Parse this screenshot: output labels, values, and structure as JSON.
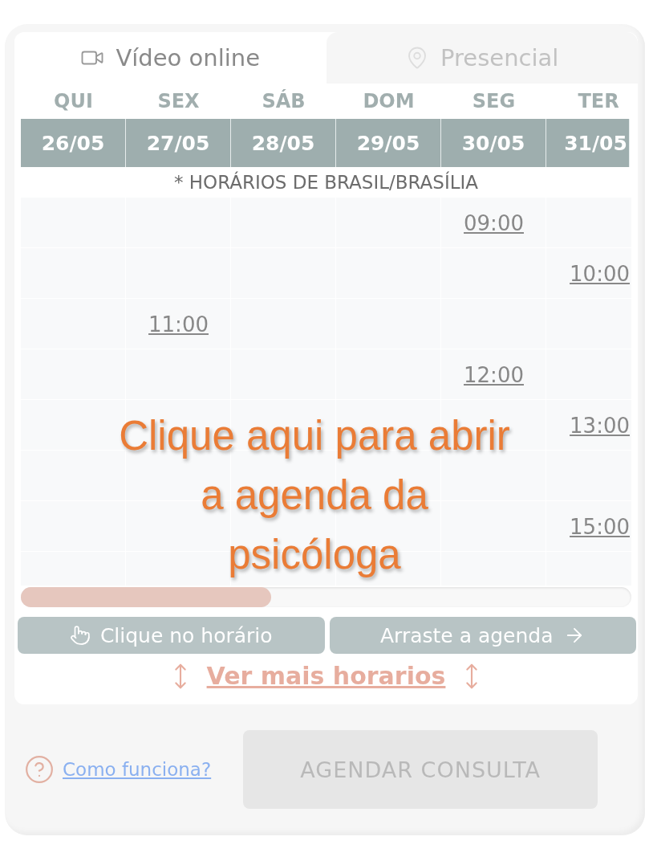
{
  "tabs": [
    {
      "label": "Vídeo online",
      "kind": "video",
      "selected": true
    },
    {
      "label": "Presencial",
      "kind": "location",
      "selected": false
    }
  ],
  "days": [
    {
      "weekday": "QUI",
      "date": "26/05"
    },
    {
      "weekday": "SEX",
      "date": "27/05"
    },
    {
      "weekday": "SÁB",
      "date": "28/05"
    },
    {
      "weekday": "DOM",
      "date": "29/05"
    },
    {
      "weekday": "SEG",
      "date": "30/05"
    },
    {
      "weekday": "TER",
      "date": "31/05"
    }
  ],
  "timezone_note": "* HORÁRIOS DE BRASIL/BRASÍLIA",
  "rows": [
    {
      "cells": [
        {},
        {},
        {},
        {},
        {
          "time": "09:00"
        },
        {}
      ]
    },
    {
      "cells": [
        {},
        {},
        {},
        {},
        {},
        {
          "time": "10:00"
        }
      ]
    },
    {
      "cells": [
        {},
        {
          "time": "11:00"
        },
        {},
        {},
        {},
        {}
      ]
    },
    {
      "cells": [
        {},
        {},
        {},
        {},
        {
          "time": "12:00"
        },
        {}
      ]
    },
    {
      "cells": [
        {},
        {},
        {},
        {},
        {},
        {
          "time": "13:00"
        }
      ]
    },
    {
      "cells": [
        {},
        {},
        {},
        {},
        {},
        {}
      ]
    },
    {
      "cells": [
        {},
        {},
        {},
        {},
        {},
        {
          "time": "15:00"
        }
      ]
    },
    {
      "cells": [
        {},
        {},
        {},
        {},
        {},
        {}
      ]
    }
  ],
  "overlay_text": "Clique aqui para abrir a agenda da psicóloga",
  "hints": [
    {
      "label": "Clique no horário",
      "kind": "click"
    },
    {
      "label": "Arraste a agenda",
      "kind": "drag"
    }
  ],
  "more_link": "Ver mais horarios",
  "help_link": "Como funciona?",
  "book_button": {
    "label": "AGENDAR CONSULTA",
    "disabled": true
  }
}
